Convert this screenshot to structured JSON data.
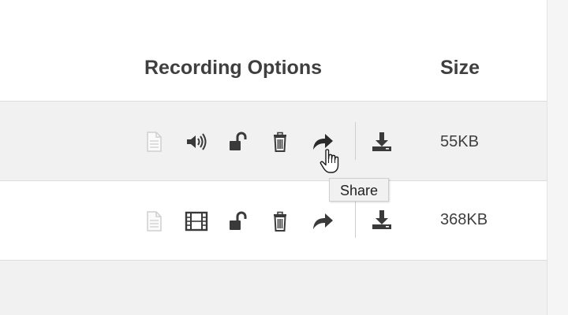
{
  "table": {
    "headers": {
      "recording_options": "Recording Options",
      "size": "Size"
    },
    "rows": [
      {
        "media_type": "audio",
        "size": "55KB"
      },
      {
        "media_type": "video",
        "size": "368KB"
      }
    ]
  },
  "tooltip": {
    "text": "Share"
  },
  "icons": {
    "row_actions": [
      "document-icon",
      "speaker-icon OR film-icon",
      "unlock-icon",
      "trash-icon",
      "share-icon",
      "download-icon"
    ]
  },
  "colors": {
    "icon_dark": "#3a3a3a",
    "icon_light": "#cfcfcf",
    "row_highlight": "#f1f1f1",
    "border": "#dcdcdc"
  }
}
